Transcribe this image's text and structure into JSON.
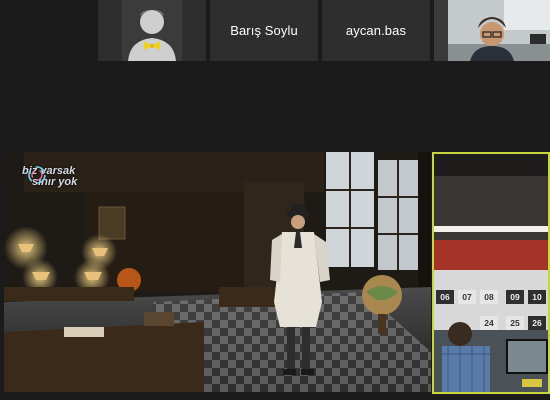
{
  "participants": [
    {
      "label": "Barış Soylu"
    },
    {
      "label": "aycan.bas"
    }
  ],
  "logo": {
    "line1": "biz varsak",
    "line2": "sınır yok"
  },
  "calendar_numbers": [
    "06",
    "07",
    "08",
    "09",
    "10",
    "24",
    "25",
    "26"
  ],
  "colors": {
    "active_speaker_border": "#c7d63a",
    "tile_bg": "#2e2e2e"
  }
}
